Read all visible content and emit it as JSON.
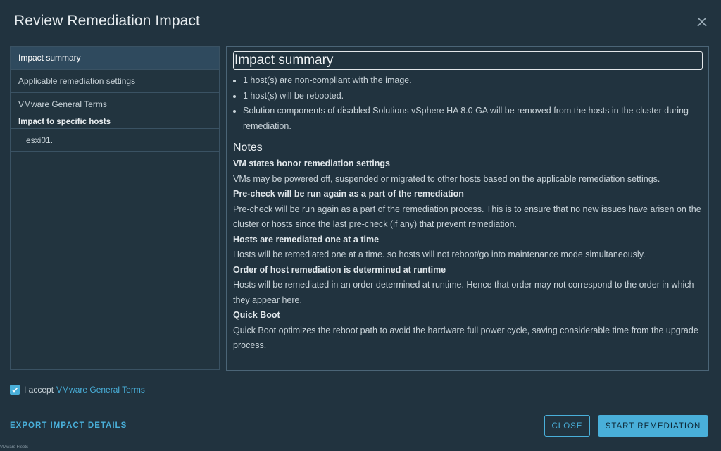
{
  "dialog": {
    "title": "Review Remediation Impact"
  },
  "sidebar": {
    "items": [
      {
        "label": "Impact summary"
      },
      {
        "label": "Applicable remediation settings"
      },
      {
        "label": "VMware General Terms"
      }
    ],
    "section_label": "Impact to specific hosts",
    "hosts": [
      {
        "label": "esxi01."
      }
    ]
  },
  "content": {
    "title": "Impact summary",
    "bullets": [
      "1 host(s) are non-compliant with the image.",
      "1 host(s) will be rebooted.",
      "Solution components of disabled Solutions vSphere HA 8.0 GA will be removed from the hosts in the cluster during remediation."
    ],
    "notes_title": "Notes",
    "notes": [
      {
        "heading": "VM states honor remediation settings",
        "body": "VMs may be powered off, suspended or migrated to other hosts based on the applicable remediation settings."
      },
      {
        "heading": "Pre-check will be run again as a part of the remediation",
        "body": "Pre-check will be run again as a part of the remediation process. This is to ensure that no new issues have arisen on the cluster or hosts since the last pre-check (if any) that prevent remediation."
      },
      {
        "heading": "Hosts are remediated one at a time",
        "body": "Hosts will be remediated one at a time. so hosts will not reboot/go into maintenance mode simultaneously."
      },
      {
        "heading": "Order of host remediation is determined at runtime",
        "body": "Hosts will be remediated in an order determined at runtime. Hence that order may not correspond to the order in which they appear here."
      },
      {
        "heading": "Quick Boot",
        "body": "Quick Boot optimizes the reboot path to avoid the hardware full power cycle, saving considerable time from the upgrade process."
      }
    ]
  },
  "footer": {
    "accept_text": "I accept",
    "accept_link": "VMware General Terms",
    "accept_checked": true,
    "export_label": "EXPORT IMPACT DETAILS",
    "close_label": "CLOSE",
    "start_label": "START REMEDIATION",
    "corner_text": "VMware Fleets"
  },
  "colors": {
    "background": "#21333f",
    "accent": "#49afd9",
    "active_item": "#2f4a5e"
  }
}
